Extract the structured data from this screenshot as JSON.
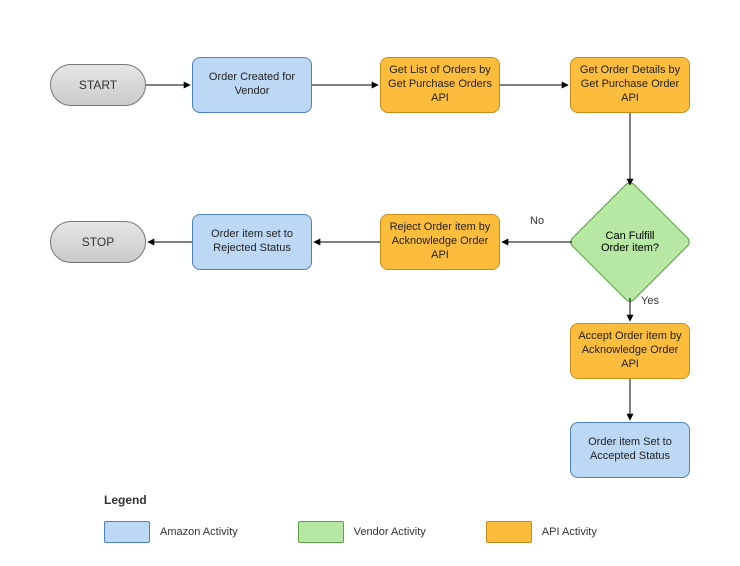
{
  "start": {
    "label": "START"
  },
  "stop": {
    "label": "STOP"
  },
  "nodes": {
    "order_created": "Order Created for Vendor",
    "get_list": "Get List of Orders by Get Purchase Orders API",
    "get_details": "Get Order Details by Get Purchase Order API",
    "can_fulfill": "Can Fulfill Order item?",
    "reject": "Reject Order item by Acknowledge Order API",
    "rejected_status": "Order item set to Rejected Status",
    "accept": "Accept Order item by Acknowledge Order API",
    "accepted_status": "Order item Set to Accepted Status"
  },
  "edges": {
    "no": "No",
    "yes": "Yes"
  },
  "legend": {
    "title": "Legend",
    "amazon": "Amazon Activity",
    "vendor": "Vendor Activity",
    "api": "API Activity"
  },
  "colors": {
    "amazon": "#bcd8f4",
    "vendor": "#b6e7a3",
    "api": "#fdbd3c"
  },
  "chart_data": {
    "type": "flowchart",
    "nodes": [
      {
        "id": "start",
        "kind": "terminator",
        "label": "START"
      },
      {
        "id": "order_created",
        "kind": "amazon",
        "label": "Order Created for Vendor"
      },
      {
        "id": "get_list",
        "kind": "api",
        "label": "Get List of Orders by Get Purchase Orders API"
      },
      {
        "id": "get_details",
        "kind": "api",
        "label": "Get Order Details by Get Purchase Order API"
      },
      {
        "id": "can_fulfill",
        "kind": "decision",
        "label": "Can Fulfill Order item?"
      },
      {
        "id": "reject",
        "kind": "api",
        "label": "Reject Order item by Acknowledge Order API"
      },
      {
        "id": "rejected_status",
        "kind": "amazon",
        "label": "Order item set to Rejected Status"
      },
      {
        "id": "stop",
        "kind": "terminator",
        "label": "STOP"
      },
      {
        "id": "accept",
        "kind": "api",
        "label": "Accept Order item by Acknowledge Order API"
      },
      {
        "id": "accepted_status",
        "kind": "amazon",
        "label": "Order item Set to Accepted Status"
      }
    ],
    "edges": [
      {
        "from": "start",
        "to": "order_created"
      },
      {
        "from": "order_created",
        "to": "get_list"
      },
      {
        "from": "get_list",
        "to": "get_details"
      },
      {
        "from": "get_details",
        "to": "can_fulfill"
      },
      {
        "from": "can_fulfill",
        "to": "reject",
        "label": "No"
      },
      {
        "from": "reject",
        "to": "rejected_status"
      },
      {
        "from": "rejected_status",
        "to": "stop"
      },
      {
        "from": "can_fulfill",
        "to": "accept",
        "label": "Yes"
      },
      {
        "from": "accept",
        "to": "accepted_status"
      }
    ],
    "legend": [
      {
        "label": "Amazon Activity",
        "color": "#bcd8f4"
      },
      {
        "label": "Vendor Activity",
        "color": "#b6e7a3"
      },
      {
        "label": "API Activity",
        "color": "#fdbd3c"
      }
    ]
  }
}
